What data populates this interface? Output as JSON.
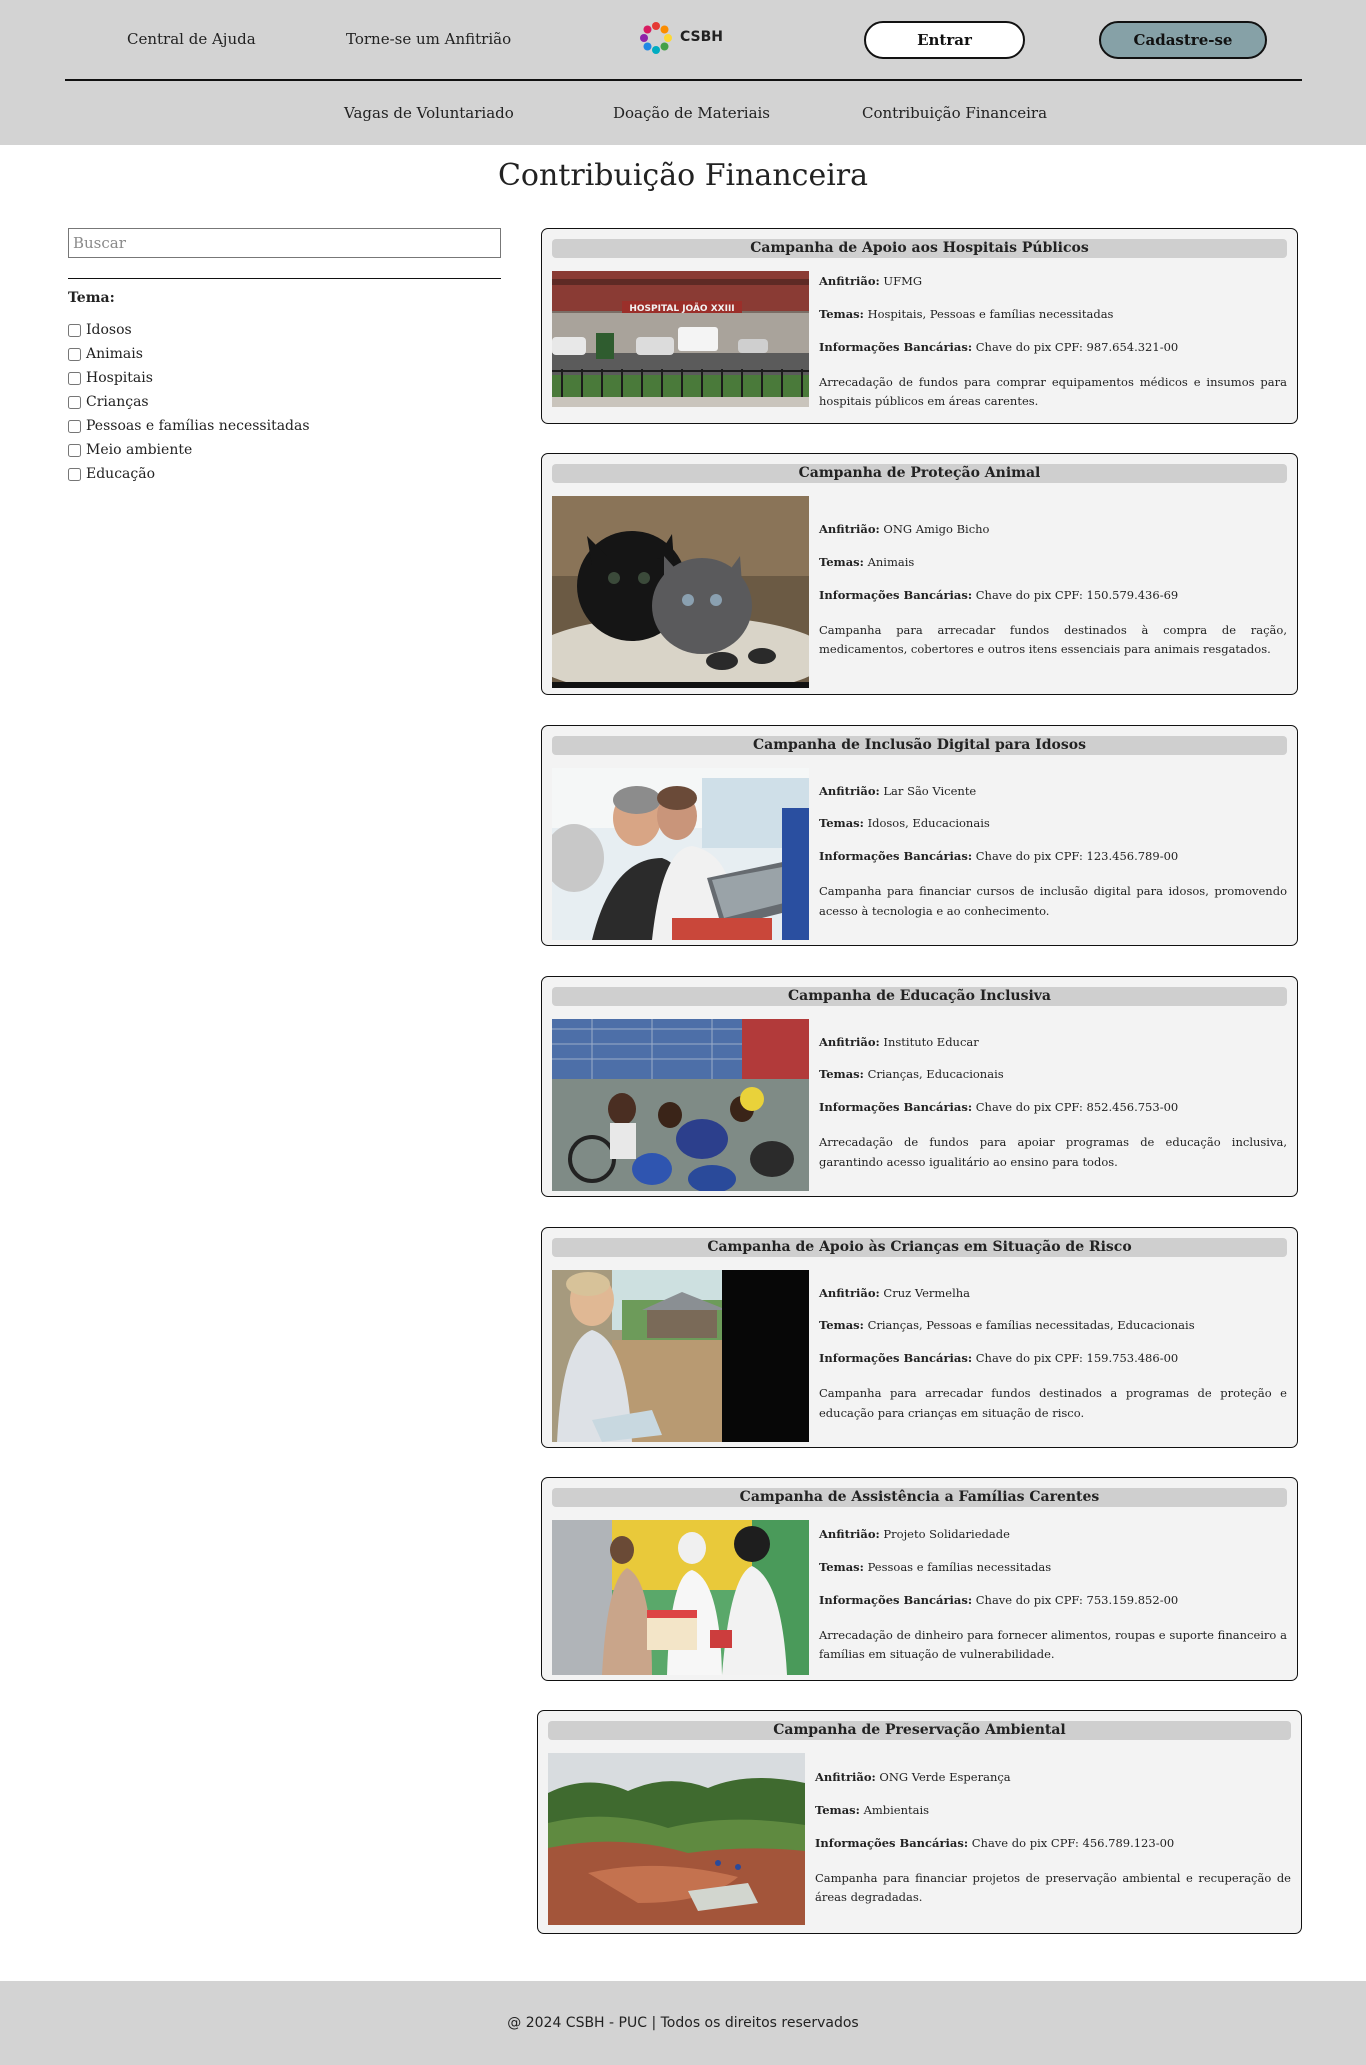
{
  "header": {
    "links": [
      "Central de Ajuda",
      "Torne-se um Anfitrião"
    ],
    "logo_text": "CSBH",
    "login_label": "Entrar",
    "signup_label": "Cadastre-se",
    "nav": [
      "Vagas de Voluntariado",
      "Doação de Materiais",
      "Contribuição Financeira"
    ]
  },
  "page_title": "Contribuição Financeira",
  "sidebar": {
    "search_placeholder": "Buscar",
    "theme_title": "Tema:",
    "themes": [
      "Idosos",
      "Animais",
      "Hospitais",
      "Crianças",
      "Pessoas e famílias necessitadas",
      "Meio ambiente",
      "Educação"
    ]
  },
  "labels": {
    "host": "Anfitrião:",
    "themes": "Temas:",
    "bank": "Informações Bancárias:"
  },
  "campaigns": [
    {
      "title": "Campanha de Apoio aos Hospitais Públicos",
      "host": "UFMG",
      "themes": "Hospitais, Pessoas e famílias necessitadas",
      "bank": "Chave do pix CPF: 987.654.321-00",
      "description": "Arrecadação de fundos para comprar equipamentos médicos e insumos para hospitais públicos em áreas carentes.",
      "photo_sign": "HOSPITAL JOÃO XXIII"
    },
    {
      "title": "Campanha de Proteção Animal",
      "host": "ONG Amigo Bicho",
      "themes": "Animais",
      "bank": "Chave do pix CPF: 150.579.436-69",
      "description": "Campanha para arrecadar fundos destinados à compra de ração, medicamentos, cobertores e outros itens essenciais para animais resgatados."
    },
    {
      "title": "Campanha de Inclusão Digital para Idosos",
      "host": "Lar São Vicente",
      "themes": "Idosos, Educacionais",
      "bank": "Chave do pix CPF: 123.456.789-00",
      "description": "Campanha para financiar cursos de inclusão digital para idosos, promovendo acesso à tecnologia e ao conhecimento."
    },
    {
      "title": "Campanha de Educação Inclusiva",
      "host": "Instituto Educar",
      "themes": "Crianças, Educacionais",
      "bank": "Chave do pix CPF: 852.456.753-00",
      "description": "Arrecadação de fundos para apoiar programas de educação inclusiva, garantindo acesso igualitário ao ensino para todos."
    },
    {
      "title": "Campanha de Apoio às Crianças em Situação de Risco",
      "host": "Cruz Vermelha",
      "themes": "Crianças, Pessoas e famílias necessitadas, Educacionais",
      "bank": "Chave do pix CPF: 159.753.486-00",
      "description": "Campanha para arrecadar fundos destinados a programas de proteção e educação para crianças em situação de risco."
    },
    {
      "title": "Campanha de Assistência a Famílias Carentes",
      "host": "Projeto Solidariedade",
      "themes": "Pessoas e famílias necessitadas",
      "bank": "Chave do pix CPF: 753.159.852-00",
      "description": "Arrecadação de dinheiro para fornecer alimentos, roupas e suporte financeiro a famílias em situação de vulnerabilidade."
    },
    {
      "title": "Campanha de Preservação Ambiental",
      "host": "ONG Verde Esperança",
      "themes": "Ambientais",
      "bank": "Chave do pix CPF: 456.789.123-00",
      "description": "Campanha para financiar projetos de preservação ambiental e recuperação de áreas degradadas."
    }
  ],
  "footer": {
    "text": "@ 2024 CSBH - PUC | Todos os direitos reservados"
  },
  "colors": {
    "header_bg": "#d3d3d3",
    "signup_button_bg": "#86a1a7",
    "card_bg": "#f3f3f3",
    "card_title_bg": "#cfcfcf"
  }
}
